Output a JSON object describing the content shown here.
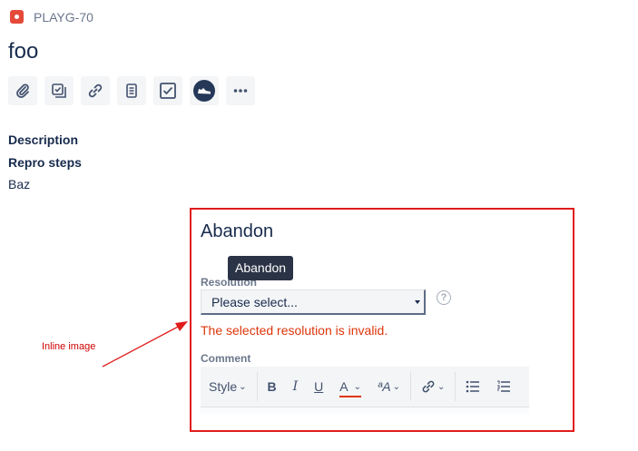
{
  "issue": {
    "key": "PLAYG-70",
    "title": "foo"
  },
  "toolbar": {
    "icons": [
      "paperclip-icon",
      "subtask-icon",
      "link-icon",
      "page-icon",
      "checkbox-icon",
      "sneaker-icon",
      "more-icon"
    ]
  },
  "content": {
    "description_label": "Description",
    "repro_label": "Repro steps",
    "repro_text": "Baz"
  },
  "annotation": {
    "caption": "Inline image",
    "color": "#d00000"
  },
  "dialog": {
    "title": "Abandon",
    "tooltip": "Abandon",
    "resolution_label": "Resolution",
    "resolution_value": "Please select...",
    "error": "The selected resolution is invalid.",
    "comment_label": "Comment",
    "border_color": "#e01c1c",
    "editor": {
      "style_label": "Style",
      "bold": "B",
      "italic": "I",
      "underline": "U",
      "text_color": "A",
      "text_effects": "ªA"
    }
  },
  "colors": {
    "error": "#de350b",
    "issue_type": "#e5493a",
    "primary_text": "#172b4d",
    "muted_text": "#6b778c"
  }
}
